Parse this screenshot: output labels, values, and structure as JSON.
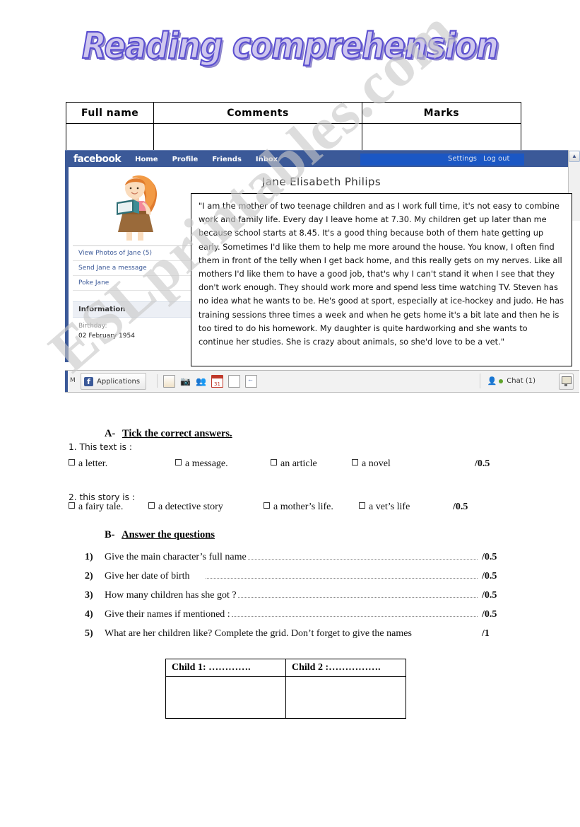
{
  "title": "Reading comprehension",
  "watermark": "ESLprintables.com",
  "marks_table": {
    "headers": [
      "Full name",
      "Comments",
      "Marks"
    ]
  },
  "facebook": {
    "logo": "facebook",
    "nav": [
      "Home",
      "Profile",
      "Friends",
      "Inbox"
    ],
    "settings": "Settings",
    "logout": "Log out",
    "profile_name": "Jane  Elisabeth Philips",
    "side_links": [
      "View Photos of Jane (5)",
      "Send Jane a message",
      "Poke Jane"
    ],
    "information_header": "Information",
    "birthday_label": "Birthday:",
    "birthday_value": "02 February 1954",
    "taskbar": {
      "m_label": "M",
      "applications": "Applications",
      "chat": "Chat (1)",
      "chat_count": "1"
    }
  },
  "passage": "\"I am the mother of two teenage children and as I work full time, it's not easy to combine work and family life. Every day I leave home at 7.30. My children get up later than me because school starts at 8.45. It's a good thing because both of them hate getting up early. Sometimes I'd like them to help me more around the house. You know, I often find them in front of the telly when I get back home, and this really gets on my nerves. Like all mothers I'd like them to have a good job, that's why I can't stand it when I see that they don't work enough. They should work more and spend less time watching TV. Steven has no idea what he wants to be. He's good at sport, especially at ice-hockey and judo. He has training sessions three times a week and when he gets home it's a bit late and then he is too tired to do his homework. My daughter is quite hardworking and she wants to continue her studies. She is crazy about animals, so she'd love to be a vet.\"",
  "section_a": {
    "letter": "A-",
    "heading": "Tick the correct answers.",
    "q1": {
      "stem": "1. This text is :",
      "options": [
        "a letter.",
        "a message.",
        "an article",
        "a novel"
      ],
      "score": "/0.5"
    },
    "q2": {
      "stem": "2. this story is :",
      "options": [
        "a fairy tale.",
        "a detective story",
        "a mother’s life.",
        "a vet’s life"
      ],
      "score": "/0.5"
    }
  },
  "section_b": {
    "letter": "B-",
    "heading": "Answer the questions",
    "questions": [
      {
        "num": "1)",
        "text": "Give the main character’s full name",
        "score": "/0.5"
      },
      {
        "num": "2)",
        "text": "Give her date of birth",
        "score": "/0.5"
      },
      {
        "num": "3)",
        "text": "How many children has she got ?",
        "score": "/0.5"
      },
      {
        "num": "4)",
        "text": "Give their names if mentioned :",
        "score": "/0.5"
      },
      {
        "num": "5)",
        "text": "What are her children like? Complete the grid.  Don’t forget to give the names",
        "score": "/1"
      }
    ]
  },
  "child_grid": {
    "headers": [
      "Child 1: ………….",
      "Child 2 :……………."
    ]
  },
  "colors": {
    "facebook_blue": "#3b5998",
    "search_blue": "#1b57c4",
    "title_fill": "#cfc7ee",
    "title_stroke": "#5b4fd0",
    "chat_green": "#5ea32a",
    "watermark_gray": "#c9c9c9"
  }
}
